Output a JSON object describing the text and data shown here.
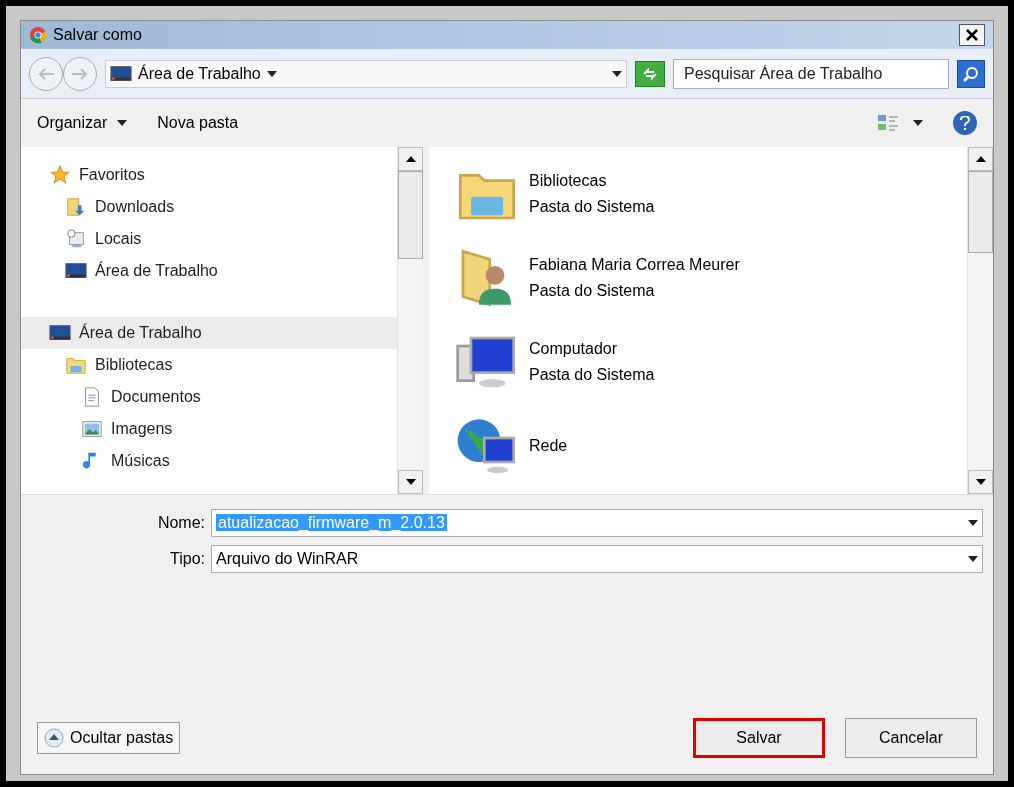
{
  "window": {
    "title": "Salvar como"
  },
  "address": {
    "location": "Área de Trabalho",
    "search_placeholder": "Pesquisar Área de Trabalho"
  },
  "toolbar": {
    "organize": "Organizar",
    "new_folder": "Nova pasta"
  },
  "nav_tree": [
    {
      "label": "Favoritos",
      "kind": "star",
      "selected": false,
      "children": [
        {
          "label": "Downloads",
          "kind": "download",
          "selected": false
        },
        {
          "label": "Locais",
          "kind": "recent",
          "selected": false
        },
        {
          "label": "Área de Trabalho",
          "kind": "desktop",
          "selected": false
        }
      ]
    },
    {
      "label": "Área de Trabalho",
      "kind": "desktop",
      "selected": true,
      "children": [
        {
          "label": "Bibliotecas",
          "kind": "library",
          "selected": false,
          "children": [
            {
              "label": "Documentos",
              "kind": "document",
              "selected": false
            },
            {
              "label": "Imagens",
              "kind": "image",
              "selected": false
            },
            {
              "label": "Músicas",
              "kind": "music",
              "selected": false
            }
          ]
        }
      ]
    }
  ],
  "items": [
    {
      "name": "Bibliotecas",
      "subtitle": "Pasta do Sistema",
      "kind": "library"
    },
    {
      "name": "Fabiana Maria Correa Meurer",
      "subtitle": "Pasta do Sistema",
      "kind": "user"
    },
    {
      "name": "Computador",
      "subtitle": "Pasta do Sistema",
      "kind": "computer"
    },
    {
      "name": "Rede",
      "kind": "network"
    }
  ],
  "form": {
    "name_label": "Nome:",
    "name_value": "atualizacao_firmware_m_2.0.13",
    "type_label": "Tipo:",
    "type_value": "Arquivo do WinRAR"
  },
  "hide_folders": "Ocultar pastas",
  "buttons": [
    {
      "label": "Salvar",
      "highlighted": true
    },
    {
      "label": "Cancelar",
      "highlighted": false
    }
  ]
}
